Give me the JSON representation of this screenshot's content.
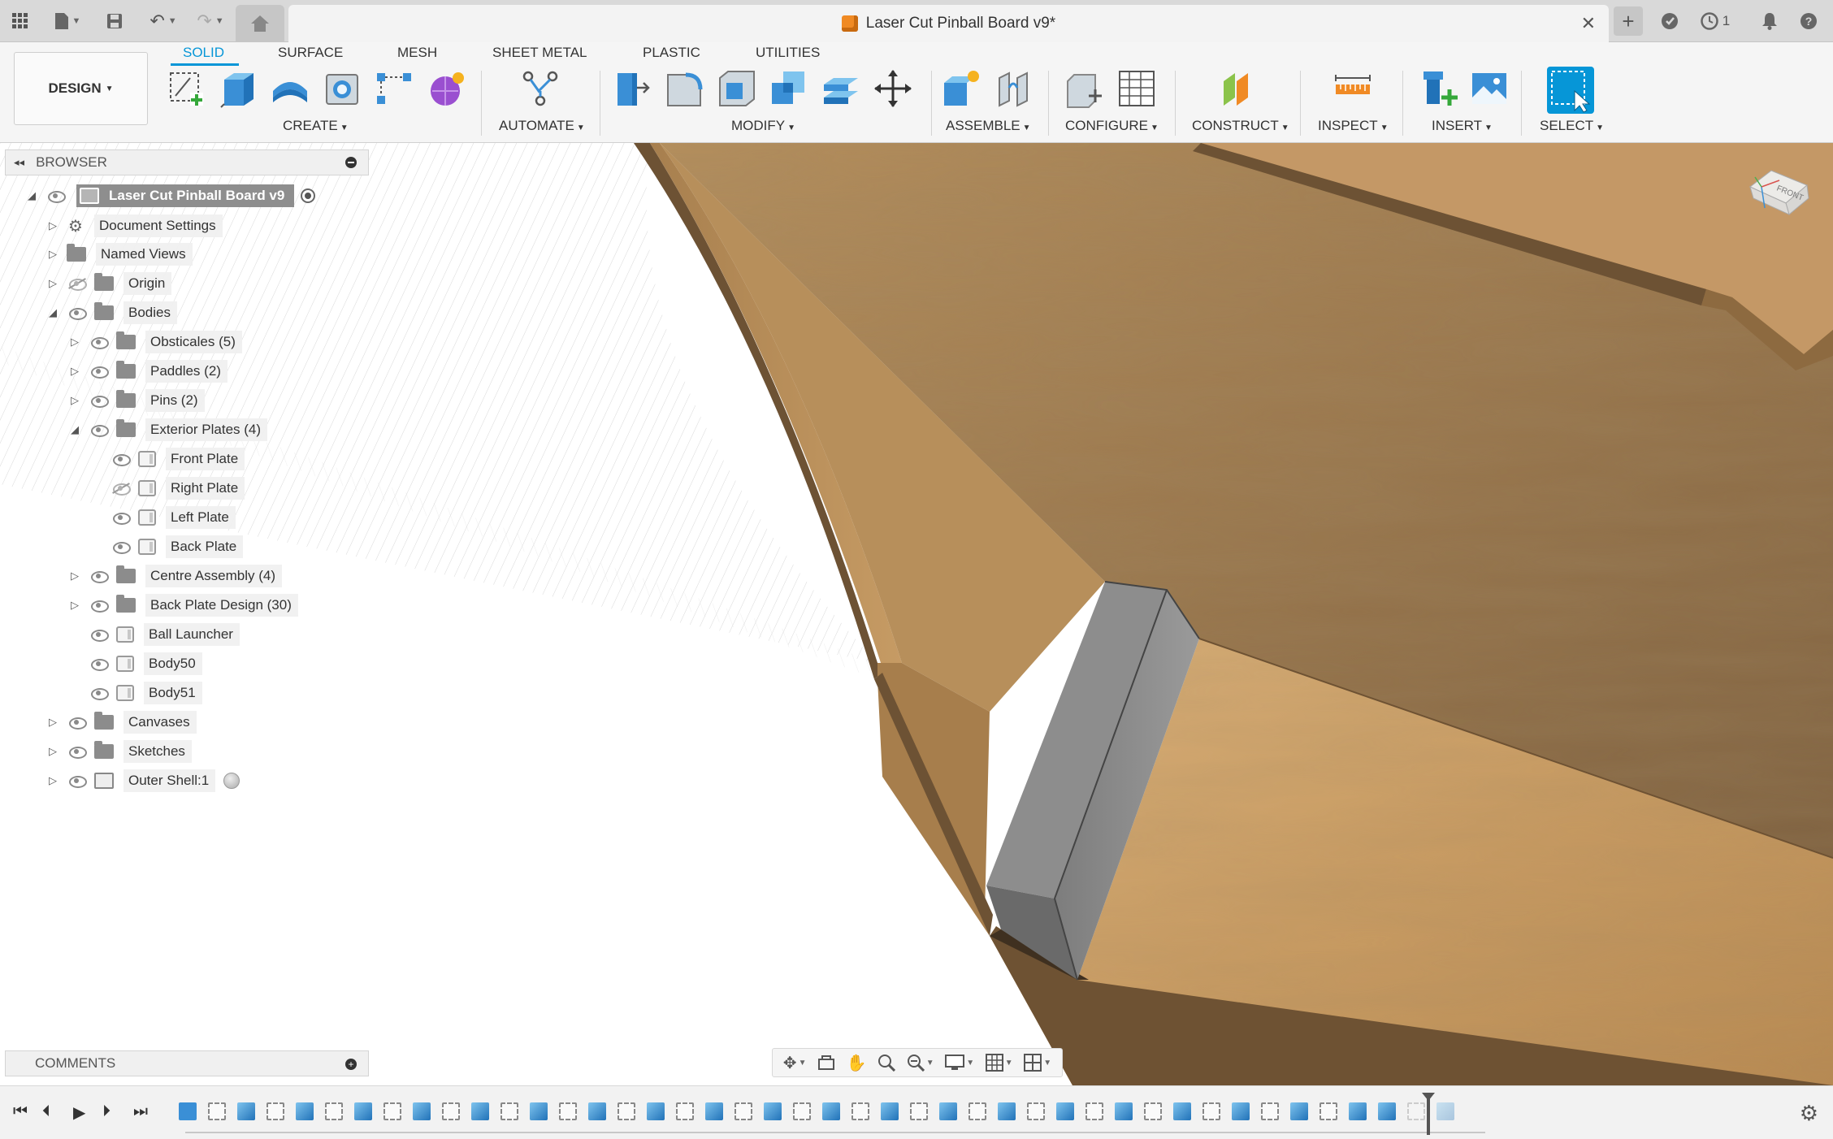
{
  "document": {
    "title": "Laser Cut Pinball Board v9*"
  },
  "topbar": {
    "notifications_count": "1"
  },
  "ribbon": {
    "workspace_label": "DESIGN",
    "tabs": [
      {
        "label": "SOLID"
      },
      {
        "label": "SURFACE"
      },
      {
        "label": "MESH"
      },
      {
        "label": "SHEET METAL"
      },
      {
        "label": "PLASTIC"
      },
      {
        "label": "UTILITIES"
      }
    ],
    "groups": {
      "create": "CREATE",
      "automate": "AUTOMATE",
      "modify": "MODIFY",
      "assemble": "ASSEMBLE",
      "configure": "CONFIGURE",
      "construct": "CONSTRUCT",
      "inspect": "INSPECT",
      "insert": "INSERT",
      "select": "SELECT"
    }
  },
  "browser": {
    "title": "BROWSER",
    "root": "Laser Cut Pinball Board v9",
    "items": {
      "document_settings": "Document Settings",
      "named_views": "Named Views",
      "origin": "Origin",
      "bodies": "Bodies",
      "obstacles": "Obsticales (5)",
      "paddles": "Paddles (2)",
      "pins": "Pins (2)",
      "exterior_plates": "Exterior Plates (4)",
      "front_plate": "Front Plate",
      "right_plate": "Right Plate",
      "left_plate": "Left Plate",
      "back_plate": "Back Plate",
      "centre_assembly": "Centre Assembly (4)",
      "back_plate_design": "Back Plate Design (30)",
      "ball_launcher": "Ball Launcher",
      "body50": "Body50",
      "body51": "Body51",
      "canvases": "Canvases",
      "sketches": "Sketches",
      "outer_shell": "Outer Shell:1"
    }
  },
  "comments": {
    "title": "COMMENTS"
  },
  "viewcube": {
    "face_label": "FRONT"
  },
  "colors": {
    "accent": "#0696d7",
    "wood_light": "#c9a26b",
    "wood_dark": "#8b6a42",
    "spacer_grey": "#8a8a8a"
  }
}
